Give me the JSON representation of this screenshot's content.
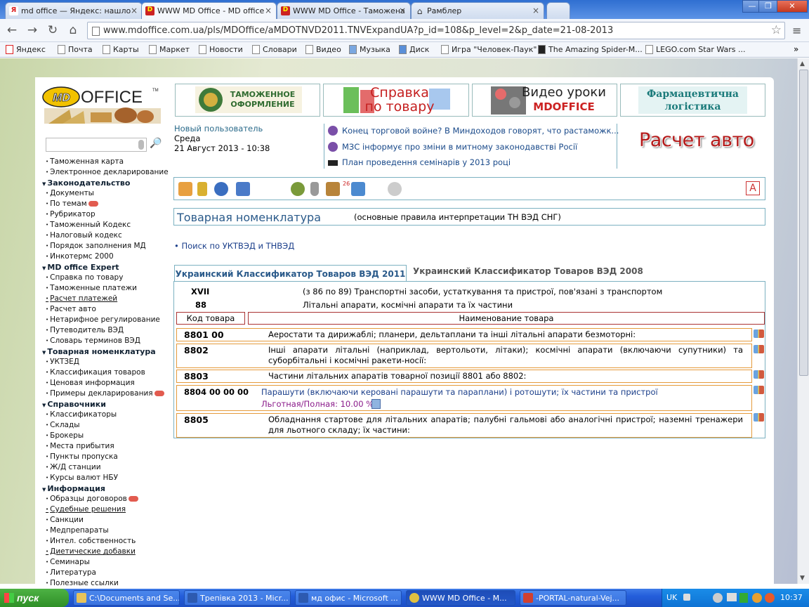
{
  "browser": {
    "tabs": [
      {
        "label": "md office — Яндекс: нашло",
        "active": false
      },
      {
        "label": "WWW MD Office - MD office",
        "active": true
      },
      {
        "label": "WWW MD Office - Таможена",
        "active": false
      },
      {
        "label": "Рамблер",
        "active": false
      }
    ],
    "url": "www.mdoffice.com.ua/pls/MDOffice/aMDOTNVD2011.TNVExpandUA?p_id=108&p_level=2&p_date=21-08-2013",
    "bookmarks": [
      "Яндекс",
      "Почта",
      "Карты",
      "Маркет",
      "Новости",
      "Словари",
      "Видео",
      "Музыка",
      "Диск",
      "Игра \"Человек-Паук\"",
      "The Amazing Spider-M...",
      "LEGO.com Star Wars ..."
    ],
    "bookmarks_more": "»"
  },
  "banners": {
    "customs_line1": "ТАМОЖЕННОЕ",
    "customs_line2": "ОФОРМЛЕНИЕ",
    "goods_line1": "Справка",
    "goods_line2": "по товару",
    "video_line1": "Видео уроки",
    "video_line2": "MDOFFICE",
    "pharma_line1": "Фармацевтична",
    "pharma_line2": "логістика"
  },
  "logo": {
    "md": "MD",
    "office": "OFFICE",
    "tm": "TM"
  },
  "user": {
    "name": "Новый пользователь",
    "weekday": "Среда",
    "datetime": "21 Август 2013 - 10:38"
  },
  "news": [
    "Конец торговой войне? В Миндоходов говорят, что растаможк...",
    "МЗС інформує про зміни в митному законодавстві Росії",
    "План проведення семінарів у 2013 році"
  ],
  "raschet_auto": "Расчет авто",
  "icon_badge": "26",
  "font_btn": "A",
  "sidebar": [
    {
      "type": "item",
      "label": "Таможенная карта"
    },
    {
      "type": "item",
      "label": "Электронное декларирование"
    },
    {
      "type": "head",
      "label": "Законодательство"
    },
    {
      "type": "item",
      "label": "Документы"
    },
    {
      "type": "item",
      "label": "По темам",
      "cloud": true
    },
    {
      "type": "item",
      "label": "Рубрикатор"
    },
    {
      "type": "item",
      "label": "Таможенный Кодекс"
    },
    {
      "type": "item",
      "label": "Налоговый кодекс"
    },
    {
      "type": "item",
      "label": "Порядок заполнения МД"
    },
    {
      "type": "item",
      "label": "Инкотермс 2000"
    },
    {
      "type": "head",
      "label": "MD office Expert"
    },
    {
      "type": "item",
      "label": "Справка по товару"
    },
    {
      "type": "item",
      "label": "Таможенные платежи"
    },
    {
      "type": "item",
      "label": "Расчет платежей",
      "underline": true
    },
    {
      "type": "item",
      "label": "Расчет авто"
    },
    {
      "type": "item",
      "label": "Нетарифное регулирование"
    },
    {
      "type": "item",
      "label": "Путеводитель ВЭД"
    },
    {
      "type": "item",
      "label": "Словарь терминов ВЭД"
    },
    {
      "type": "head",
      "label": "Товарная номенклатура"
    },
    {
      "type": "item",
      "label": "УКТЗЕД"
    },
    {
      "type": "item",
      "label": "Классификация товаров"
    },
    {
      "type": "item",
      "label": "Ценовая информация"
    },
    {
      "type": "item",
      "label": "Примеры декларирования",
      "cloud": true
    },
    {
      "type": "head",
      "label": "Справочники"
    },
    {
      "type": "item",
      "label": "Классификаторы"
    },
    {
      "type": "item",
      "label": "Склады"
    },
    {
      "type": "item",
      "label": "Брокеры"
    },
    {
      "type": "item",
      "label": "Места прибытия"
    },
    {
      "type": "item",
      "label": "Пункты пропуска"
    },
    {
      "type": "item",
      "label": "Ж/Д станции"
    },
    {
      "type": "item",
      "label": "Курсы валют НБУ"
    },
    {
      "type": "head",
      "label": "Информация"
    },
    {
      "type": "item",
      "label": "Образцы договоров",
      "cloud": true
    },
    {
      "type": "item",
      "label": "Судебные решения",
      "underline": true
    },
    {
      "type": "item",
      "label": "Санкции"
    },
    {
      "type": "item",
      "label": "Медпрепараты"
    },
    {
      "type": "item",
      "label": "Интел. собственность"
    },
    {
      "type": "item",
      "label": "Диетические добавки",
      "underline": true
    },
    {
      "type": "item",
      "label": "Семинары"
    },
    {
      "type": "item",
      "label": "Литература"
    },
    {
      "type": "item",
      "label": "Полезные ссылки"
    }
  ],
  "main": {
    "title": "Товарная номенклатура",
    "rules": "(основные правила интерпретации ТН ВЭД СНГ)",
    "search_link": "• Поиск по УКТВЭД и ТНВЭД",
    "tabs": [
      "Украинский Классификатор Товаров ВЭД 2011",
      "Украинский Классификатор Товаров ВЭД 2008"
    ],
    "section_code": "XVII",
    "section_text": "(з 86 по 89) Транспортні засоби, устаткування та пристрої, пов'язані з транспортом",
    "group_code": "88",
    "group_text": "Літальні апарати, космічні апарати та їх частини",
    "col_code": "Код товара",
    "col_name": "Наименование товара",
    "rows": [
      {
        "code": "8801 00",
        "desc": "Аеростати та дирижаблі; планери, дельтаплани та інші літальні апарати безмоторні:"
      },
      {
        "code": "8802",
        "desc": "Інші апарати літальні (наприклад, вертольоти, літаки); космічні апарати (включаючи супутники) та суборбітальні і космічні ракети-носії:"
      },
      {
        "code": "8803",
        "desc": "Частини літальних апаратів товарної позиції 8801 або 8802:"
      },
      {
        "code": "8804 00 00 00",
        "desc": "Парашути (включаючи керовані парашути та параплани) і ротошути; їх частини та пристрої",
        "rate": "Льготная/Полная: 10.00 %"
      },
      {
        "code": "8805",
        "desc": "Обладнання стартове для літальних апаратів; палубні гальмові або аналогічні пристрої; наземні тренажери для льотного складу; їх частини:"
      }
    ]
  },
  "taskbar": {
    "start": "пуск",
    "tasks": [
      "C:\\Documents and Se...",
      "Трепівка 2013 - Micr...",
      "мд офис - Microsoft ...",
      "WWW MD Office - M...",
      "-PORTAL-natural-Vej..."
    ],
    "lang": "UK",
    "time": "10:37"
  },
  "colors": {
    "accent": "#2a5a8a",
    "row_border": "#e59b3c",
    "header_border": "#aa3333",
    "rate": "#8a1a8a"
  }
}
